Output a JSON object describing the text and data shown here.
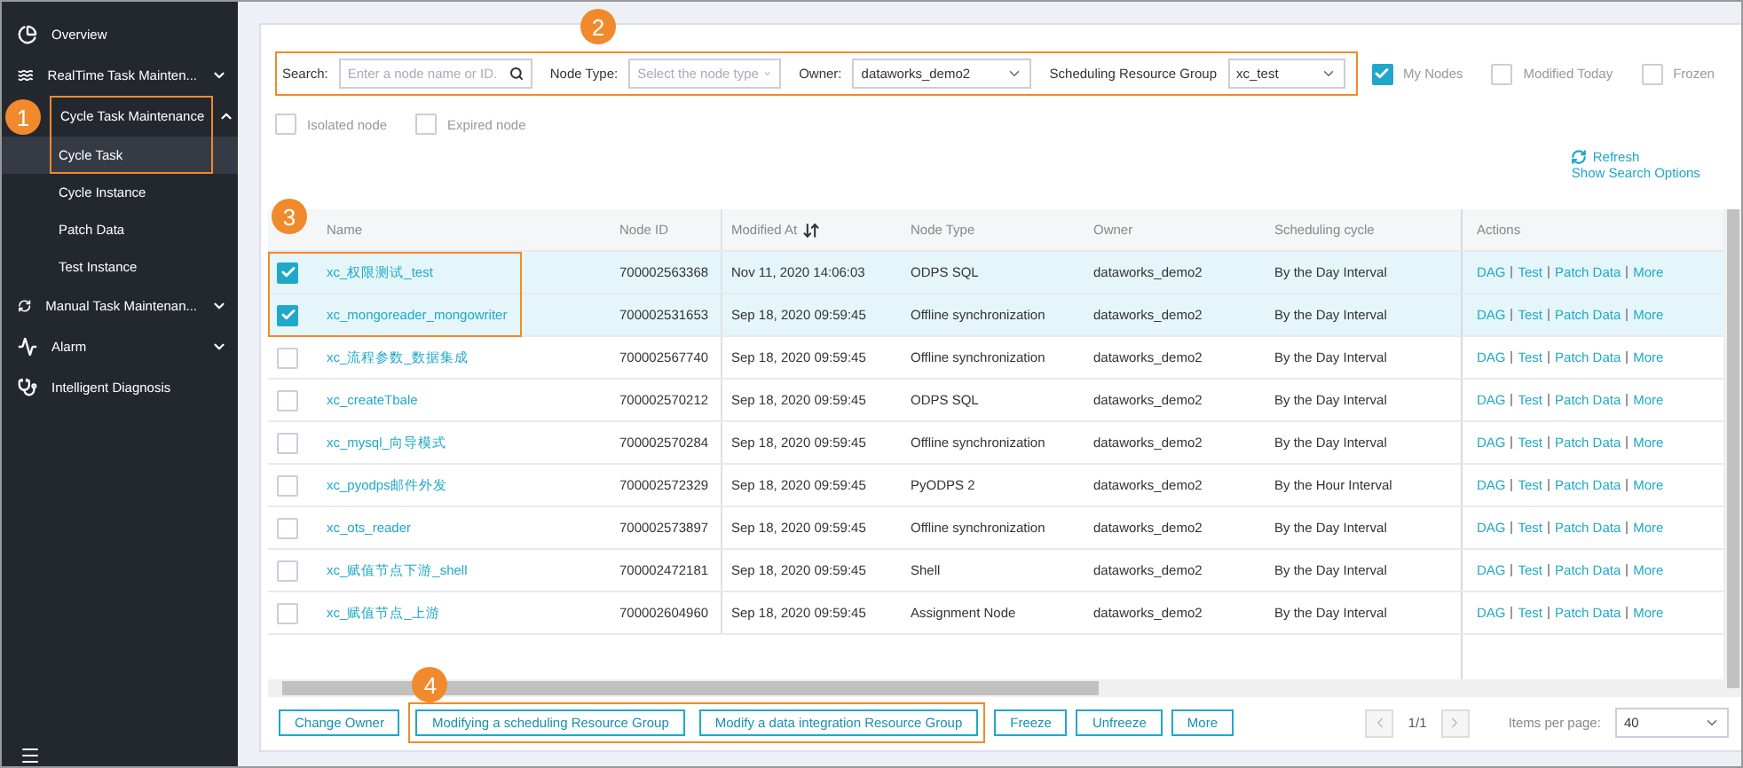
{
  "sidebar": {
    "callout": "1",
    "items": [
      {
        "label": "Overview",
        "kind": "item"
      },
      {
        "label": "RealTime Task Mainten...",
        "kind": "group",
        "expanded": false
      },
      {
        "label": "Cycle Task Maintenance",
        "kind": "group",
        "expanded": true,
        "children": [
          {
            "label": "Cycle Task",
            "selected": true
          },
          {
            "label": "Cycle Instance",
            "selected": false
          },
          {
            "label": "Patch Data",
            "selected": false
          },
          {
            "label": "Test Instance",
            "selected": false
          }
        ]
      },
      {
        "label": "Manual Task Maintenan...",
        "kind": "group",
        "expanded": false
      },
      {
        "label": "Alarm",
        "kind": "group",
        "expanded": false
      },
      {
        "label": "Intelligent Diagnosis",
        "kind": "item"
      }
    ]
  },
  "filters": {
    "callout": "2",
    "search": {
      "label": "Search:",
      "placeholder": "Enter a node name or ID."
    },
    "node_type": {
      "label": "Node Type:",
      "placeholder": "Select the node type"
    },
    "owner": {
      "label": "Owner:",
      "value": "dataworks_demo2"
    },
    "resource_group": {
      "label": "Scheduling Resource Group",
      "value": "xc_test"
    },
    "checkboxes": [
      {
        "label": "My Nodes",
        "checked": true
      },
      {
        "label": "Modified Today",
        "checked": false
      },
      {
        "label": "Frozen",
        "checked": false
      },
      {
        "label": "Isolated node",
        "checked": false
      },
      {
        "label": "Expired node",
        "checked": false
      }
    ],
    "refresh": "Refresh",
    "show_options": "Show Search Options"
  },
  "table": {
    "callout": "3",
    "columns": [
      "Name",
      "Node ID",
      "Modified At",
      "Node Type",
      "Owner",
      "Scheduling cycle",
      "Actions"
    ],
    "rows": [
      {
        "selected": true,
        "name": "xc_权限测试_test",
        "node_id": "700002563368",
        "modified": "Nov 11, 2020 14:06:03",
        "type": "ODPS SQL",
        "owner": "dataworks_demo2",
        "cycle": "By the Day Interval",
        "actions": [
          "DAG",
          "Test",
          "Patch Data",
          "More"
        ]
      },
      {
        "selected": true,
        "name": "xc_mongoreader_mongowriter",
        "node_id": "700002531653",
        "modified": "Sep 18, 2020 09:59:45",
        "type": "Offline synchronization",
        "owner": "dataworks_demo2",
        "cycle": "By the Day Interval",
        "actions": [
          "DAG",
          "Test",
          "Patch Data",
          "More"
        ]
      },
      {
        "selected": false,
        "name": "xc_流程参数_数据集成",
        "node_id": "700002567740",
        "modified": "Sep 18, 2020 09:59:45",
        "type": "Offline synchronization",
        "owner": "dataworks_demo2",
        "cycle": "By the Day Interval",
        "actions": [
          "DAG",
          "Test",
          "Patch Data",
          "More"
        ]
      },
      {
        "selected": false,
        "name": "xc_createTbale",
        "node_id": "700002570212",
        "modified": "Sep 18, 2020 09:59:45",
        "type": "ODPS SQL",
        "owner": "dataworks_demo2",
        "cycle": "By the Day Interval",
        "actions": [
          "DAG",
          "Test",
          "Patch Data",
          "More"
        ]
      },
      {
        "selected": false,
        "name": "xc_mysql_向导模式",
        "node_id": "700002570284",
        "modified": "Sep 18, 2020 09:59:45",
        "type": "Offline synchronization",
        "owner": "dataworks_demo2",
        "cycle": "By the Day Interval",
        "actions": [
          "DAG",
          "Test",
          "Patch Data",
          "More"
        ]
      },
      {
        "selected": false,
        "name": "xc_pyodps邮件外发",
        "node_id": "700002572329",
        "modified": "Sep 18, 2020 09:59:45",
        "type": "PyODPS 2",
        "owner": "dataworks_demo2",
        "cycle": "By the Hour Interval",
        "actions": [
          "DAG",
          "Test",
          "Patch Data",
          "More"
        ]
      },
      {
        "selected": false,
        "name": "xc_ots_reader",
        "node_id": "700002573897",
        "modified": "Sep 18, 2020 09:59:45",
        "type": "Offline synchronization",
        "owner": "dataworks_demo2",
        "cycle": "By the Day Interval",
        "actions": [
          "DAG",
          "Test",
          "Patch Data",
          "More"
        ]
      },
      {
        "selected": false,
        "name": "xc_赋值节点下游_shell",
        "node_id": "700002472181",
        "modified": "Sep 18, 2020 09:59:45",
        "type": "Shell",
        "owner": "dataworks_demo2",
        "cycle": "By the Day Interval",
        "actions": [
          "DAG",
          "Test",
          "Patch Data",
          "More"
        ]
      },
      {
        "selected": false,
        "name": "xc_赋值节点_上游",
        "node_id": "700002604960",
        "modified": "Sep 18, 2020 09:59:45",
        "type": "Assignment Node",
        "owner": "dataworks_demo2",
        "cycle": "By the Day Interval",
        "actions": [
          "DAG",
          "Test",
          "Patch Data",
          "More"
        ]
      }
    ]
  },
  "footer": {
    "callout": "4",
    "buttons": [
      {
        "label": "Change Owner",
        "marked": false
      },
      {
        "label": "Modifying a scheduling Resource Group",
        "marked": true
      },
      {
        "label": "Modify a data integration Resource Group",
        "marked": true
      },
      {
        "label": "Freeze",
        "marked": false
      },
      {
        "label": "Unfreeze",
        "marked": false
      },
      {
        "label": "More",
        "marked": false
      }
    ],
    "page": "1/1",
    "per_page_label": "Items per page:",
    "per_page": "40"
  }
}
